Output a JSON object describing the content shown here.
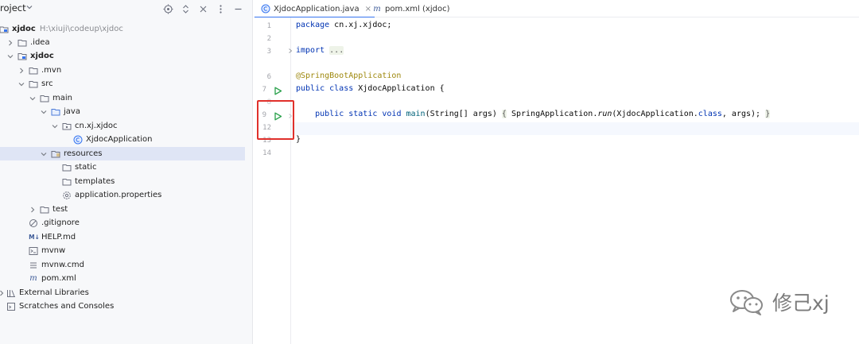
{
  "project_panel": {
    "title": "roject",
    "tree": [
      {
        "label": "xjdoc",
        "path": "H:\\xiuji\\codeup\\xjdoc",
        "icon": "module-folder-icon",
        "expanded": true
      },
      {
        "label": ".idea",
        "icon": "folder-icon",
        "expanded": false
      },
      {
        "label": "xjdoc",
        "icon": "module-folder-icon",
        "expanded": true
      },
      {
        "label": ".mvn",
        "icon": "folder-icon",
        "expanded": false
      },
      {
        "label": "src",
        "icon": "folder-icon",
        "expanded": true
      },
      {
        "label": "main",
        "icon": "folder-icon",
        "expanded": true
      },
      {
        "label": "java",
        "icon": "source-folder-icon",
        "expanded": true
      },
      {
        "label": "cn.xj.xjdoc",
        "icon": "package-icon",
        "expanded": true
      },
      {
        "label": "XjdocApplication",
        "icon": "java-class-icon"
      },
      {
        "label": "resources",
        "icon": "resources-folder-icon",
        "expanded": true,
        "selected": true
      },
      {
        "label": "static",
        "icon": "folder-icon"
      },
      {
        "label": "templates",
        "icon": "folder-icon"
      },
      {
        "label": "application.properties",
        "icon": "settings-file-icon"
      },
      {
        "label": "test",
        "icon": "folder-icon",
        "expanded": false
      },
      {
        "label": ".gitignore",
        "icon": "ignore-file-icon"
      },
      {
        "label": "HELP.md",
        "icon": "markdown-icon",
        "icon_text": "M↓"
      },
      {
        "label": "mvnw",
        "icon": "terminal-file-icon"
      },
      {
        "label": "mvnw.cmd",
        "icon": "text-file-icon"
      },
      {
        "label": "pom.xml",
        "icon": "maven-icon"
      },
      {
        "label": "External Libraries",
        "icon": "libraries-icon",
        "expanded": false
      },
      {
        "label": "Scratches and Consoles",
        "icon": "scratches-icon"
      }
    ]
  },
  "tabs": [
    {
      "label": "XjdocApplication.java",
      "active": true,
      "icon": "java-class-icon",
      "close": "×"
    },
    {
      "label": "pom.xml (xjdoc)",
      "active": false,
      "icon": "maven-icon"
    }
  ],
  "editor": {
    "line_numbers": [
      "1",
      "2",
      "3",
      "6",
      "7",
      "8",
      "9",
      "12",
      "13",
      "14"
    ],
    "code": {
      "line1_kw": "package",
      "line1_rest": " cn.xj.xjdoc;",
      "line3_kw": "import",
      "line3_fold": "...",
      "line6_ann": "@SpringBootApplication",
      "line7_kw": "public class",
      "line7_rest": " XjdocApplication {",
      "line9_indent": "    ",
      "line9_kw": "public static void",
      "line9_fn": "main",
      "line9_a": "(String[] args) ",
      "line9_brace_open": "{",
      "line9_b": " SpringApplication.",
      "line9_run": "run",
      "line9_c": "(XjdocApplication.",
      "line9_class_kw": "class",
      "line9_d": ", args); ",
      "line9_brace_close": "}",
      "line13": "}"
    }
  },
  "watermark": {
    "text": "修己xj",
    "icon": "wechat-logo-icon"
  },
  "colors": {
    "selection": "#dfe5f5",
    "highlight_box": "#e0302b",
    "run_icon": "#2aa14b",
    "tab_underline": "#3574f0"
  }
}
